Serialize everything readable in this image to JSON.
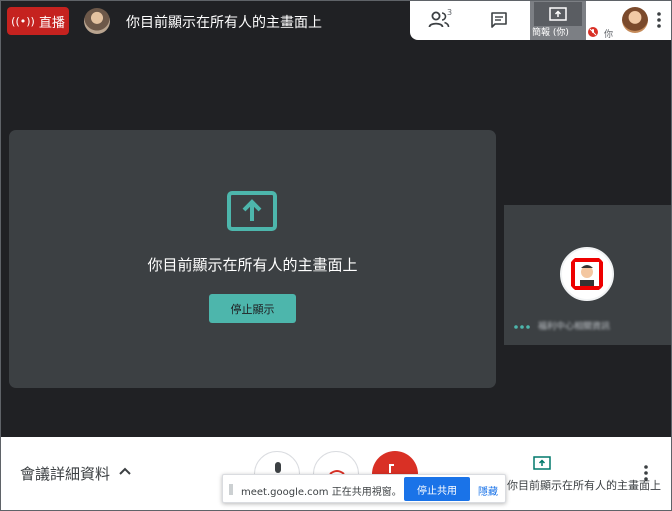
{
  "header": {
    "live_label": "直播",
    "title": "你目前顯示在所有人的主畫面上"
  },
  "top_panel": {
    "participant_count": "3",
    "self_tile_caption": "簡報 (你)",
    "you_label": "你"
  },
  "main": {
    "present_message": "你目前顯示在所有人的主畫面上",
    "stop_button_label": "停止顯示"
  },
  "participant": {
    "name": "福利中心相關資訊"
  },
  "bottom_bar": {
    "meeting_details_label": "會議詳細資料",
    "presenting_status": "你目前顯示在所有人的主畫面上"
  },
  "share_notification": {
    "message": "meet.google.com 正在共用視窗。",
    "stop_share_label": "停止共用",
    "hide_label": "隱藏"
  },
  "colors": {
    "live_red": "#c5221f",
    "accent_teal": "#4db6ac",
    "hangup_red": "#d93025",
    "link_blue": "#1a73e8",
    "background": "#202124"
  },
  "icons": [
    "live-broadcast-icon",
    "people-icon",
    "chat-icon",
    "present-screen-icon",
    "mic-off-icon",
    "more-vert-icon",
    "chevron-up-icon",
    "mic-icon",
    "camera-icon",
    "hang-up-icon",
    "drag-grip-icon",
    "more-dots-icon"
  ]
}
